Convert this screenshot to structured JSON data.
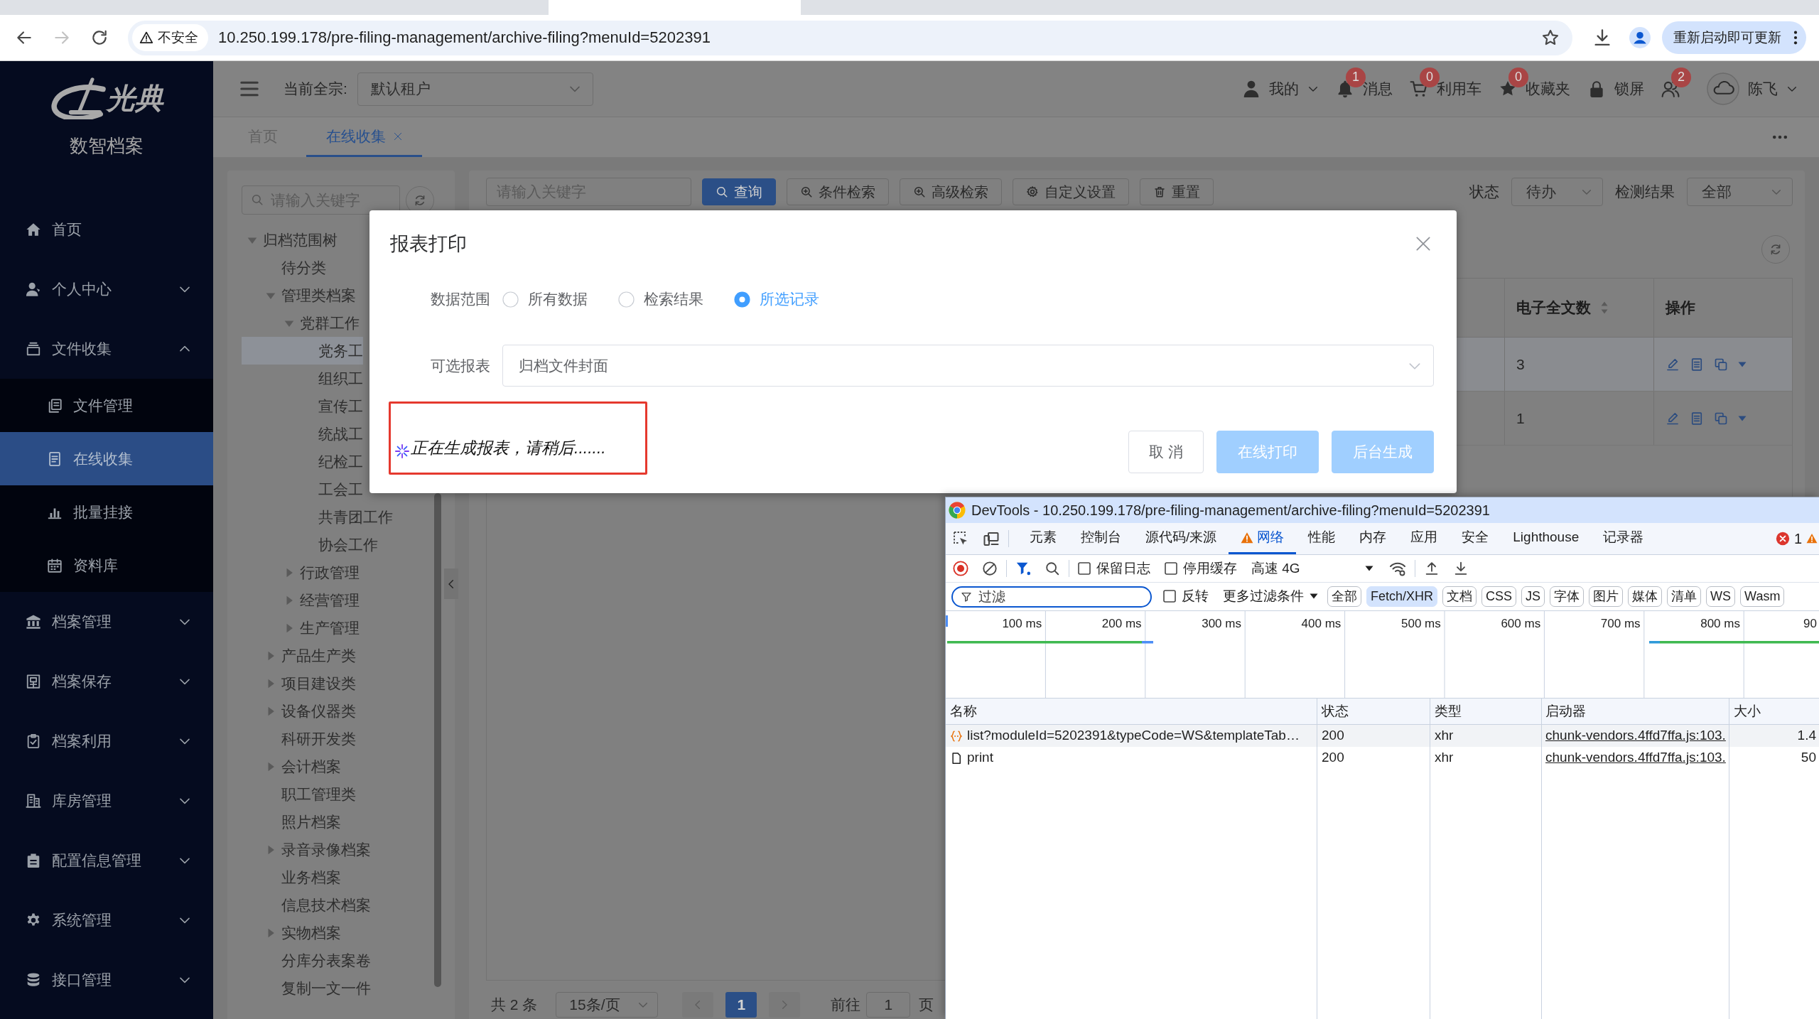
{
  "browser": {
    "nav_buttons": [
      {
        "kind": "back",
        "disabled": false
      },
      {
        "kind": "forward",
        "disabled": true
      },
      {
        "kind": "reload",
        "disabled": false
      }
    ],
    "security_label": "不安全",
    "url": "10.250.199.178/pre-filing-management/archive-filing?menuId=5202391",
    "update_button": "重新启动即可更新"
  },
  "sidebar": {
    "logo_text": "光典",
    "product_name": "数智档案",
    "items": [
      {
        "kind": "link",
        "label": "首页",
        "selected": false
      },
      {
        "kind": "menu",
        "label": "个人中心",
        "selected": false,
        "expanded": false
      },
      {
        "kind": "menu",
        "label": "文件收集",
        "selected": false,
        "expanded": true,
        "children": [
          {
            "label": "文件管理",
            "selected": false
          },
          {
            "label": "在线收集",
            "selected": true
          },
          {
            "label": "批量挂接",
            "selected": false
          },
          {
            "label": "资料库",
            "selected": false
          }
        ]
      },
      {
        "kind": "menu",
        "label": "档案管理",
        "selected": false,
        "expanded": false
      },
      {
        "kind": "menu",
        "label": "档案保存",
        "selected": false,
        "expanded": false
      },
      {
        "kind": "menu",
        "label": "档案利用",
        "selected": false,
        "expanded": false
      },
      {
        "kind": "menu",
        "label": "库房管理",
        "selected": false,
        "expanded": false
      },
      {
        "kind": "menu",
        "label": "配置信息管理",
        "selected": false,
        "expanded": false
      },
      {
        "kind": "menu",
        "label": "系统管理",
        "selected": false,
        "expanded": false
      },
      {
        "kind": "menu",
        "label": "接口管理",
        "selected": false,
        "expanded": false
      }
    ]
  },
  "header": {
    "fonds_label": "当前全宗:",
    "fonds_value": "默认租户",
    "actions": [
      {
        "kind": "dropdown",
        "label": "我的"
      },
      {
        "kind": "button",
        "label": "消息",
        "badge": "1"
      },
      {
        "kind": "button",
        "label": "利用车",
        "badge": "0"
      },
      {
        "kind": "button",
        "label": "收藏夹",
        "badge": "0"
      },
      {
        "kind": "button",
        "label": "锁屏"
      },
      {
        "kind": "button",
        "badge": "2"
      }
    ],
    "user_name": "陈飞"
  },
  "tabs": [
    {
      "label": "首页",
      "selected": false,
      "closable": false
    },
    {
      "label": "在线收集",
      "selected": true,
      "closable": true
    }
  ],
  "tree": {
    "search_placeholder": "请输入关键字",
    "nodes": [
      {
        "label": "归档范围树",
        "kind": "branch",
        "expanded": true,
        "selected": false,
        "children": [
          {
            "label": "待分类",
            "kind": "leaf",
            "selected": false
          },
          {
            "label": "管理类档案",
            "kind": "branch",
            "expanded": true,
            "selected": false,
            "children": [
              {
                "label": "党群工作",
                "kind": "branch",
                "expanded": true,
                "selected": false,
                "children": [
                  {
                    "label": "党务工",
                    "kind": "leaf",
                    "selected": true
                  },
                  {
                    "label": "组织工",
                    "kind": "leaf",
                    "selected": false
                  },
                  {
                    "label": "宣传工",
                    "kind": "leaf",
                    "selected": false
                  },
                  {
                    "label": "统战工",
                    "kind": "leaf",
                    "selected": false
                  },
                  {
                    "label": "纪检工",
                    "kind": "leaf",
                    "selected": false
                  },
                  {
                    "label": "工会工",
                    "kind": "leaf",
                    "selected": false
                  },
                  {
                    "label": "共青团工作",
                    "kind": "leaf",
                    "selected": false
                  },
                  {
                    "label": "协会工作",
                    "kind": "leaf",
                    "selected": false
                  }
                ]
              },
              {
                "label": "行政管理",
                "kind": "branch",
                "expanded": false,
                "selected": false
              },
              {
                "label": "经营管理",
                "kind": "branch",
                "expanded": false,
                "selected": false
              },
              {
                "label": "生产管理",
                "kind": "branch",
                "expanded": false,
                "selected": false
              }
            ]
          },
          {
            "label": "产品生产类",
            "kind": "branch",
            "expanded": false,
            "selected": false
          },
          {
            "label": "项目建设类",
            "kind": "branch",
            "expanded": false,
            "selected": false
          },
          {
            "label": "设备仪器类",
            "kind": "branch",
            "expanded": false,
            "selected": false
          },
          {
            "label": "科研开发类",
            "kind": "leaf",
            "selected": false
          },
          {
            "label": "会计档案",
            "kind": "branch",
            "expanded": false,
            "selected": false
          },
          {
            "label": "职工管理类",
            "kind": "leaf",
            "selected": false
          },
          {
            "label": "照片档案",
            "kind": "leaf",
            "selected": false
          },
          {
            "label": "录音录像档案",
            "kind": "branch",
            "expanded": false,
            "selected": false
          },
          {
            "label": "业务档案",
            "kind": "leaf",
            "selected": false
          },
          {
            "label": "信息技术档案",
            "kind": "leaf",
            "selected": false
          },
          {
            "label": "实物档案",
            "kind": "branch",
            "expanded": false,
            "selected": false
          },
          {
            "label": "分库分表案卷",
            "kind": "leaf",
            "selected": false
          },
          {
            "label": "复制一文一件",
            "kind": "leaf",
            "selected": false
          }
        ]
      }
    ]
  },
  "toolbar": {
    "search_placeholder": "请输入关键字",
    "buttons": [
      {
        "kind": "primary",
        "label": "查询"
      },
      {
        "kind": "default",
        "label": "条件检索"
      },
      {
        "kind": "default",
        "label": "高级检索"
      },
      {
        "kind": "default",
        "label": "自定义设置"
      },
      {
        "kind": "default",
        "label": "重置"
      }
    ],
    "filters": [
      {
        "label": "状态",
        "value": "待办"
      },
      {
        "label": "检测结果",
        "value": "全部"
      }
    ]
  },
  "table": {
    "columns": [
      {
        "label": "电子全文数",
        "sortable": true
      },
      {
        "label": "操作",
        "sortable": false
      }
    ],
    "rows": [
      {
        "selected": true,
        "count": "3"
      },
      {
        "selected": false,
        "count": "1"
      }
    ]
  },
  "pagination": {
    "total": "共 2 条",
    "page_size": "15条/页",
    "prev": {
      "disabled": true
    },
    "pages": [
      {
        "label": "1",
        "selected": true
      }
    ],
    "next": {
      "disabled": true
    },
    "goto_label": "前往",
    "goto_value": "1",
    "goto_suffix": "页"
  },
  "dialog": {
    "title": "报表打印",
    "fields": [
      {
        "kind": "radio",
        "label": "数据范围",
        "options": [
          {
            "label": "所有数据",
            "selected": false
          },
          {
            "label": "检索结果",
            "selected": false
          },
          {
            "label": "所选记录",
            "selected": true
          }
        ]
      },
      {
        "kind": "select",
        "label": "可选报表",
        "value": "归档文件封面"
      }
    ],
    "loading_text": "正在生成报表，请稍后.......",
    "buttons": [
      {
        "kind": "default",
        "label": "取 消",
        "disabled": false
      },
      {
        "kind": "primary",
        "label": "在线打印",
        "disabled": true
      },
      {
        "kind": "primary",
        "label": "后台生成",
        "disabled": true
      }
    ]
  },
  "devtools": {
    "title": "DevTools - 10.250.199.178/pre-filing-management/archive-filing?menuId=5202391",
    "tabs": [
      {
        "label": "元素",
        "selected": false,
        "warning": false
      },
      {
        "label": "控制台",
        "selected": false,
        "warning": false
      },
      {
        "label": "源代码/来源",
        "selected": false,
        "warning": false
      },
      {
        "label": "网络",
        "selected": true,
        "warning": true
      },
      {
        "label": "性能",
        "selected": false,
        "warning": false
      },
      {
        "label": "内存",
        "selected": false,
        "warning": false
      },
      {
        "label": "应用",
        "selected": false,
        "warning": false
      },
      {
        "label": "安全",
        "selected": false,
        "warning": false
      },
      {
        "label": "Lighthouse",
        "selected": false,
        "warning": false
      },
      {
        "label": "记录器",
        "selected": false,
        "warning": false
      }
    ],
    "error_count": "1",
    "recording": true,
    "filter_toggle": true,
    "options": [
      {
        "kind": "checkbox",
        "label": "保留日志",
        "checked": false
      },
      {
        "kind": "checkbox",
        "label": "停用缓存",
        "checked": false
      },
      {
        "kind": "select",
        "label": "高速 4G"
      }
    ],
    "filter_placeholder": "过滤",
    "invert": {
      "label": "反转",
      "checked": false
    },
    "more_filters": "更多过滤条件",
    "types": [
      {
        "label": "全部",
        "selected": false
      },
      {
        "label": "Fetch/XHR",
        "selected": true
      },
      {
        "label": "文档",
        "selected": false
      },
      {
        "label": "CSS",
        "selected": false
      },
      {
        "label": "JS",
        "selected": false
      },
      {
        "label": "字体",
        "selected": false
      },
      {
        "label": "图片",
        "selected": false
      },
      {
        "label": "媒体",
        "selected": false
      },
      {
        "label": "清单",
        "selected": false
      },
      {
        "label": "WS",
        "selected": false
      },
      {
        "label": "Wasm",
        "selected": false
      }
    ],
    "timeline_ticks": [
      "100 ms",
      "200 ms",
      "300 ms",
      "400 ms",
      "500 ms",
      "600 ms",
      "700 ms",
      "800 ms",
      "90"
    ],
    "columns": [
      "名称",
      "状态",
      "类型",
      "启动器",
      "大小"
    ],
    "requests": [
      {
        "kind": "fetch",
        "name": "list?moduleId=5202391&typeCode=WS&templateTab…",
        "status": "200",
        "type": "xhr",
        "initiator": "chunk-vendors.4ffd7ffa.js:103.",
        "size": "1.4"
      },
      {
        "kind": "document",
        "name": "print",
        "status": "200",
        "type": "xhr",
        "initiator": "chunk-vendors.4ffd7ffa.js:103.",
        "size": "50"
      }
    ]
  }
}
